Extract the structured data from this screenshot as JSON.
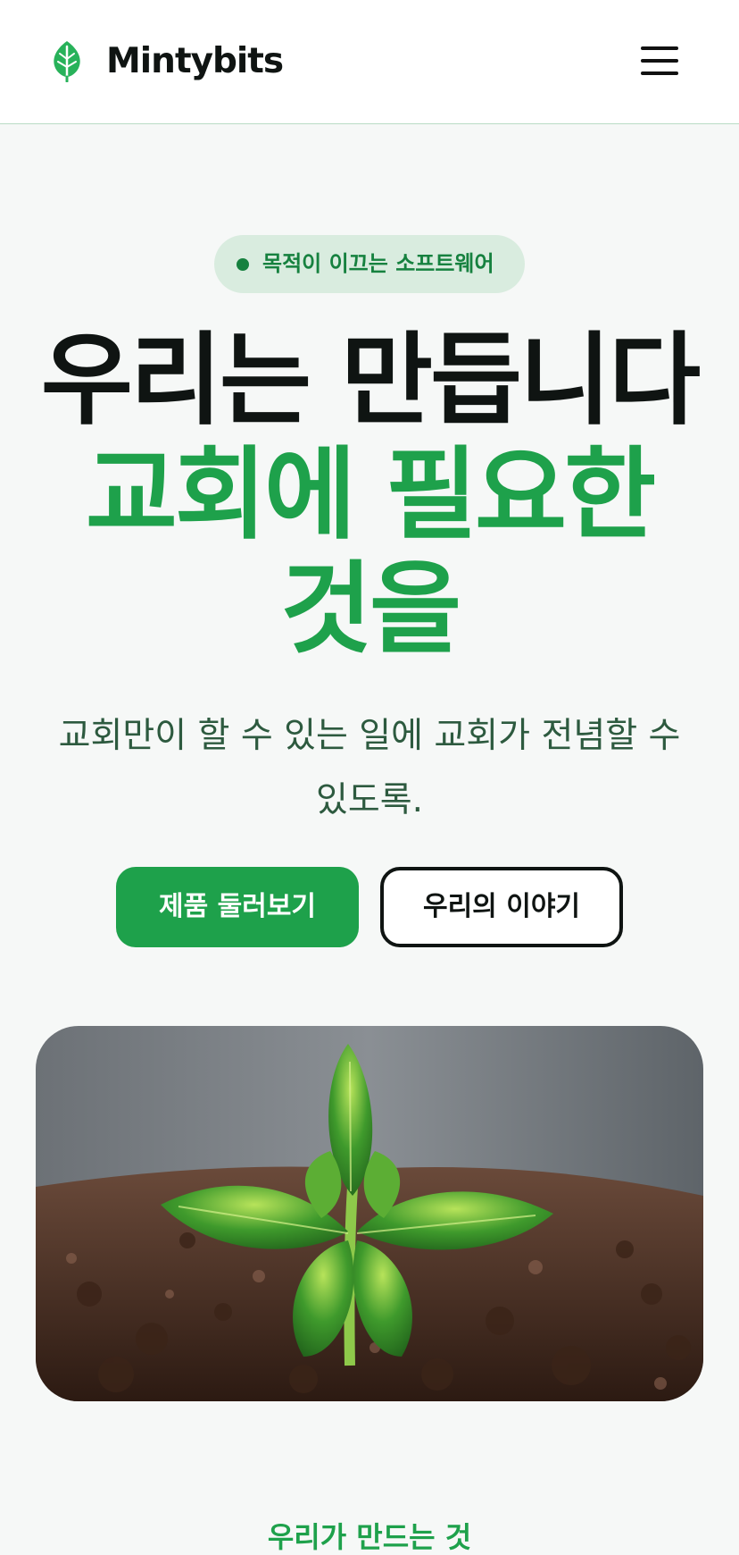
{
  "header": {
    "brand": "Mintybits",
    "logo_icon": "leaf-icon",
    "menu_icon": "hamburger-menu-icon"
  },
  "hero": {
    "badge": "목적이 이끄는 소프트웨어",
    "headline_line1": "우리는 만듭니다",
    "headline_line2": "교회에 필요한",
    "headline_line3": "것을",
    "subtitle": "교회만이 할 수 있는 일에 교회가 전념할 수 있도록.",
    "primary_button": "제품 둘러보기",
    "secondary_button": "우리의 이야기",
    "image_alt": "흙에서 자라는 민트 새싹"
  },
  "next_section": {
    "partial_heading": "우리가 만드는 것"
  },
  "colors": {
    "accent": "#1ea14b",
    "badge_bg": "#d9ecdf",
    "badge_text": "#16813f",
    "text_dark": "#0f1412",
    "subtitle": "#2d5a3f",
    "background": "#f6f8f7"
  }
}
